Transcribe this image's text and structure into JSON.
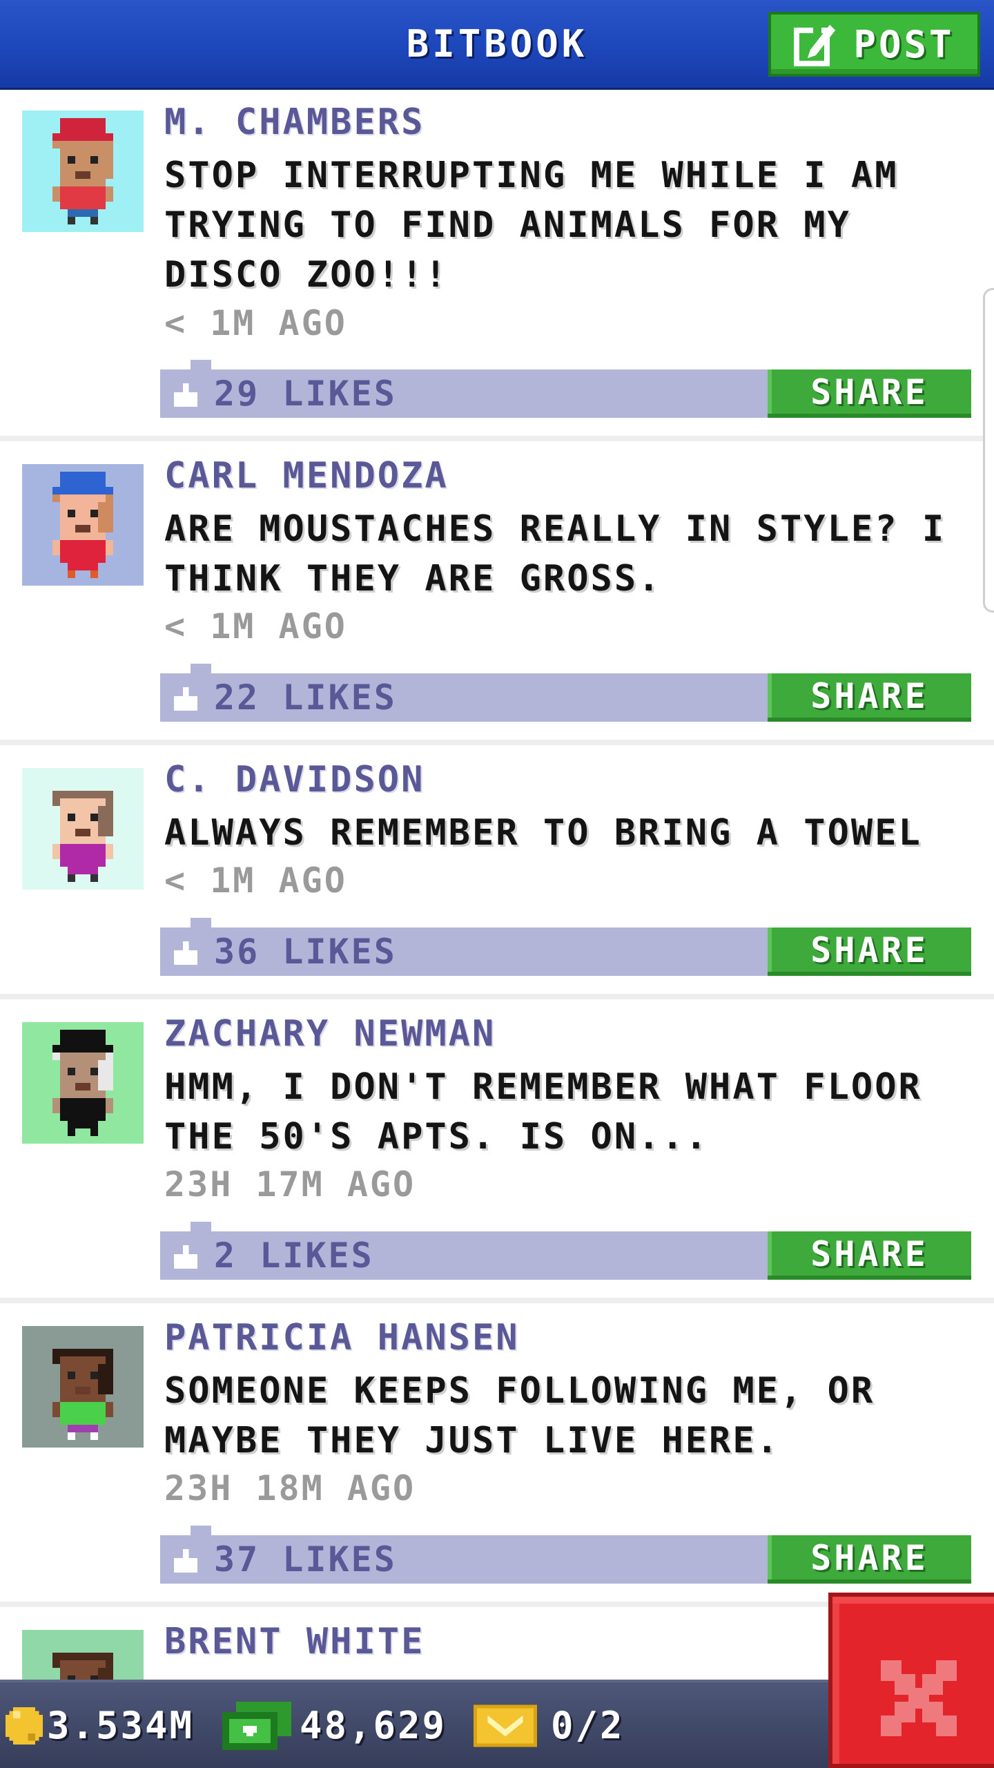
{
  "header": {
    "title": "BITBOOK",
    "post_label": "POST",
    "post_icon": "edit-icon"
  },
  "feed": [
    {
      "author": "M. CHAMBERS",
      "message": "STOP INTERRUPTING ME WHILE I AM TRYING TO FIND ANIMALS FOR MY DISCO ZOO!!!",
      "time": "< 1M AGO",
      "likes": "29 LIKES",
      "share_label": "SHARE",
      "avatar": {
        "bg": "#9ef0f4",
        "skin": "#c99068",
        "hair": "#c99068",
        "hat": "#d0233c",
        "shirt": "#e23a45",
        "pants": "#2c6ab2",
        "shoes": "#333333"
      }
    },
    {
      "author": "CARL MENDOZA",
      "message": "ARE MOUSTACHES REALLY IN STYLE? I THINK THEY ARE GROSS.",
      "time": "< 1M AGO",
      "likes": "22 LIKES",
      "share_label": "SHARE",
      "avatar": {
        "bg": "#a6b4e0",
        "skin": "#f2b59a",
        "hair": "#d08a60",
        "hat": "#2d64d2",
        "shirt": "#e0233c",
        "pants": "#e0233c",
        "shoes": "#e05a2a"
      }
    },
    {
      "author": "C. DAVIDSON",
      "message": "ALWAYS REMEMBER TO BRING A TOWEL",
      "time": "< 1M AGO",
      "likes": "36 LIKES",
      "share_label": "SHARE",
      "avatar": {
        "bg": "#dcfaf2",
        "skin": "#f2c4a8",
        "hair": "#8a6a58",
        "hat": null,
        "shirt": "#b02aa8",
        "pants": "#b02aa8",
        "shoes": "#333333"
      }
    },
    {
      "author": "ZACHARY NEWMAN",
      "message": "HMM, I DON'T REMEMBER WHAT FLOOR THE 50'S APTS. IS ON...",
      "time": "23H 17M AGO",
      "likes": "2 LIKES",
      "share_label": "SHARE",
      "avatar": {
        "bg": "#90e8a0",
        "skin": "#b59078",
        "hair": "#e8e8e8",
        "hat": "#111111",
        "shirt": "#111111",
        "pants": "#111111",
        "shoes": "#111111"
      }
    },
    {
      "author": "PATRICIA HANSEN",
      "message": "SOMEONE KEEPS FOLLOWING ME, OR MAYBE THEY JUST LIVE HERE.",
      "time": "23H 18M AGO",
      "likes": "37 LIKES",
      "share_label": "SHARE",
      "avatar": {
        "bg": "#8a9a94",
        "skin": "#7a4a32",
        "hair": "#2a1a12",
        "hat": null,
        "shirt": "#4ad04a",
        "pants": "#a040b0",
        "shoes": "#ffffff"
      }
    },
    {
      "author": "BRENT WHITE",
      "message": "",
      "time": "",
      "likes": "",
      "share_label": "",
      "avatar": {
        "bg": "#90d8a8",
        "skin": "#7a4a32",
        "hair": "#4a2a1a",
        "hat": null,
        "shirt": "#4a2a1a",
        "pants": "#333333",
        "shoes": "#333333"
      }
    }
  ],
  "footer": {
    "coins": "3.534M",
    "coin_icon": "coin-icon",
    "bux": "48,629",
    "bux_icon": "bux-icon",
    "tickets": "0/2",
    "ticket_icon": "ticket-icon"
  },
  "close_button": {
    "icon": "close-icon"
  }
}
